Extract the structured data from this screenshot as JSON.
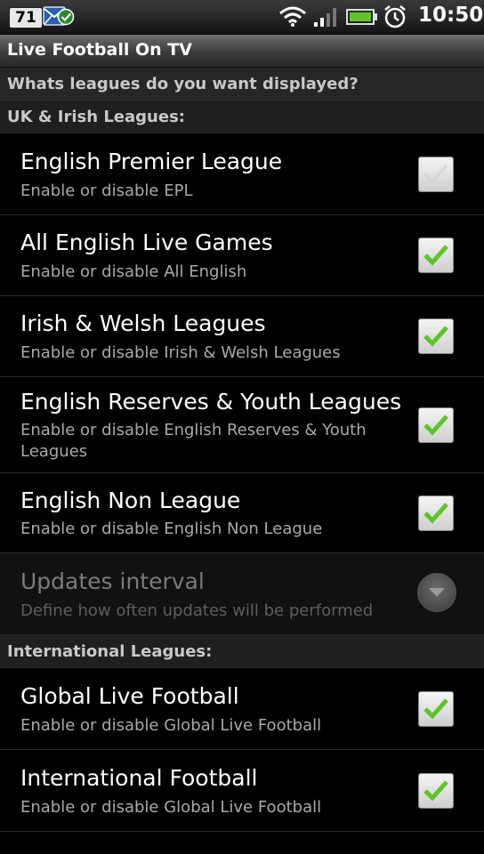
{
  "status_bar": {
    "notification_count": "71",
    "time": "10:50",
    "icons": [
      "badge-icon",
      "mail-icon",
      "sync-ok-icon",
      "wifi-icon",
      "signal-icon",
      "battery-icon",
      "alarm-icon"
    ]
  },
  "title_bar": {
    "title": "Live Football On TV"
  },
  "prompt": "Whats leagues do you want displayed?",
  "sections": {
    "uk": "UK & Irish Leagues:",
    "international": "International Leagues:"
  },
  "items": [
    {
      "title": "English Premier League",
      "summary": "Enable or disable EPL",
      "checked": false
    },
    {
      "title": "All English Live Games",
      "summary": "Enable or disable All English",
      "checked": true
    },
    {
      "title": "Irish & Welsh Leagues",
      "summary": "Enable or disable Irish & Welsh Leagues",
      "checked": true
    },
    {
      "title": "English Reserves & Youth Leagues",
      "summary": "Enable or disable English Reserves & Youth Leagues",
      "checked": true
    },
    {
      "title": "English Non League",
      "summary": "Enable or disable English Non League",
      "checked": true
    },
    {
      "title": "Updates interval",
      "summary": "Define how often updates will be performed",
      "disabled": true,
      "control": "dropdown"
    },
    {
      "title": "Global Live Football",
      "summary": "Enable or disable Global Live Football",
      "checked": true
    },
    {
      "title": "International Football",
      "summary": "Enable or disable Global Live Football",
      "checked": true
    }
  ],
  "colors": {
    "check_green": "#5fc42b",
    "background": "#000000"
  }
}
